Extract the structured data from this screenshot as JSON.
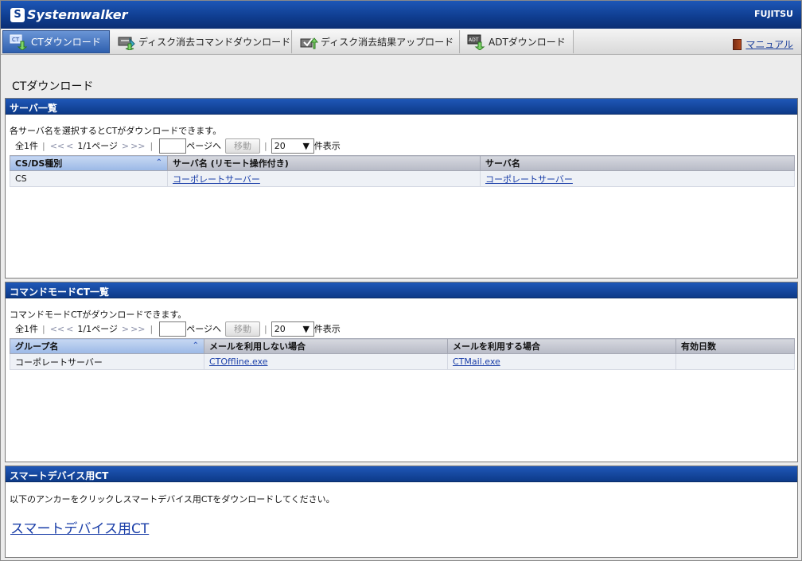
{
  "header": {
    "brand": "Systemwalker",
    "vendor": "FUJITSU"
  },
  "tabs": [
    {
      "label": "CTダウンロード",
      "active": true,
      "icon": "ct-download-icon"
    },
    {
      "label": "ディスク消去コマンドダウンロード",
      "active": false,
      "icon": "disk-erase-command-icon"
    },
    {
      "label": "ディスク消去結果アップロード",
      "active": false,
      "icon": "disk-erase-upload-icon"
    },
    {
      "label": "ADTダウンロード",
      "active": false,
      "icon": "adt-download-icon"
    }
  ],
  "manual_link": "マニュアル",
  "page_title": "CTダウンロード",
  "server_panel": {
    "title": "サーバ一覧",
    "description": "各サーバ名を選択するとCTがダウンロードできます。",
    "pager": {
      "total": "全1件",
      "first": "<<",
      "prev": "<",
      "current": "1/1ページ",
      "next": ">",
      "last": ">>",
      "goto_suffix": "ページへ",
      "move_button": "移動",
      "per_page": "20",
      "per_page_suffix": "件表示"
    },
    "columns": [
      "CS/DS種別",
      "サーバ名 (リモート操作付き)",
      "サーバ名"
    ],
    "rows": [
      [
        "CS",
        "コーポレートサーバー",
        "コーポレートサーバー"
      ]
    ]
  },
  "command_panel": {
    "title": "コマンドモードCT一覧",
    "description": "コマンドモードCTがダウンロードできます。",
    "pager": {
      "total": "全1件",
      "first": "<<",
      "prev": "<",
      "current": "1/1ページ",
      "next": ">",
      "last": ">>",
      "goto_suffix": "ページへ",
      "move_button": "移動",
      "per_page": "20",
      "per_page_suffix": "件表示"
    },
    "columns": [
      "グループ名",
      "メールを利用しない場合",
      "メールを利用する場合",
      "有効日数"
    ],
    "rows": [
      [
        "コーポレートサーバー",
        "CTOffline.exe",
        "CTMail.exe",
        ""
      ]
    ]
  },
  "smart_panel": {
    "title": "スマートデバイス用CT",
    "description": "以下のアンカーをクリックしスマートデバイス用CTをダウンロードしてください。",
    "link": "スマートデバイス用CT"
  },
  "colors": {
    "header_blue": "#0f3c8e",
    "link_blue": "#1a3ea8",
    "row_bg": "#eef1f6"
  }
}
